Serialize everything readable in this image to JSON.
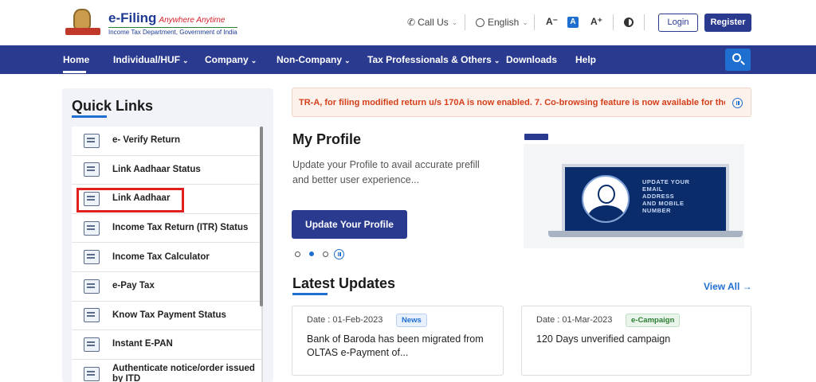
{
  "header": {
    "brand": "e-Filing",
    "tagline": "Anywhere Anytime",
    "subtitle": "Income Tax Department, Government of India",
    "call_us": "Call Us",
    "language": "English",
    "font_decrease": "A⁻",
    "font_normal": "A",
    "font_increase": "A⁺",
    "login": "Login",
    "register": "Register"
  },
  "nav": {
    "items": [
      {
        "label": "Home",
        "dropdown": false
      },
      {
        "label": "Individual/HUF",
        "dropdown": true
      },
      {
        "label": "Company",
        "dropdown": true
      },
      {
        "label": "Non-Company",
        "dropdown": true
      },
      {
        "label": "Tax Professionals & Others",
        "dropdown": true
      },
      {
        "label": "Downloads",
        "dropdown": false
      },
      {
        "label": "Help",
        "dropdown": false
      }
    ],
    "chevron": "⌄"
  },
  "quick_links": {
    "title": "Quick Links",
    "items": [
      {
        "label": "e- Verify Return"
      },
      {
        "label": "Link Aadhaar Status"
      },
      {
        "label": "Link Aadhaar"
      },
      {
        "label": "Income Tax Return (ITR) Status"
      },
      {
        "label": "Income Tax Calculator"
      },
      {
        "label": "e-Pay Tax"
      },
      {
        "label": "Know Tax Payment Status"
      },
      {
        "label": "Instant E-PAN"
      },
      {
        "label": "Authenticate notice/order issued by ITD"
      }
    ]
  },
  "ticker": {
    "text": "TR-A, for filing modified return u/s 170A is now enabled. 7. Co-browsing feature is now available for the tax"
  },
  "profile": {
    "title": "My Profile",
    "description": "Update your Profile to avail accurate prefill and better user experience...",
    "button": "Update Your Profile",
    "promo_text": "UPDATE YOUR EMAIL ADDRESS AND MOBILE NUMBER"
  },
  "latest_updates": {
    "title": "Latest Updates",
    "view_all": "View All →",
    "cards": [
      {
        "date": "Date : 01-Feb-2023",
        "badge": "News",
        "text": "Bank of Baroda has been migrated from OLTAS e-Payment of..."
      },
      {
        "date": "Date : 01-Mar-2023",
        "badge": "e-Campaign",
        "text": "120 Days unverified campaign"
      }
    ]
  },
  "colors": {
    "nav_bg": "#2a3a8f",
    "accent": "#1f6fd1",
    "ticker_text": "#d43f1a",
    "highlight": "#e02020"
  }
}
